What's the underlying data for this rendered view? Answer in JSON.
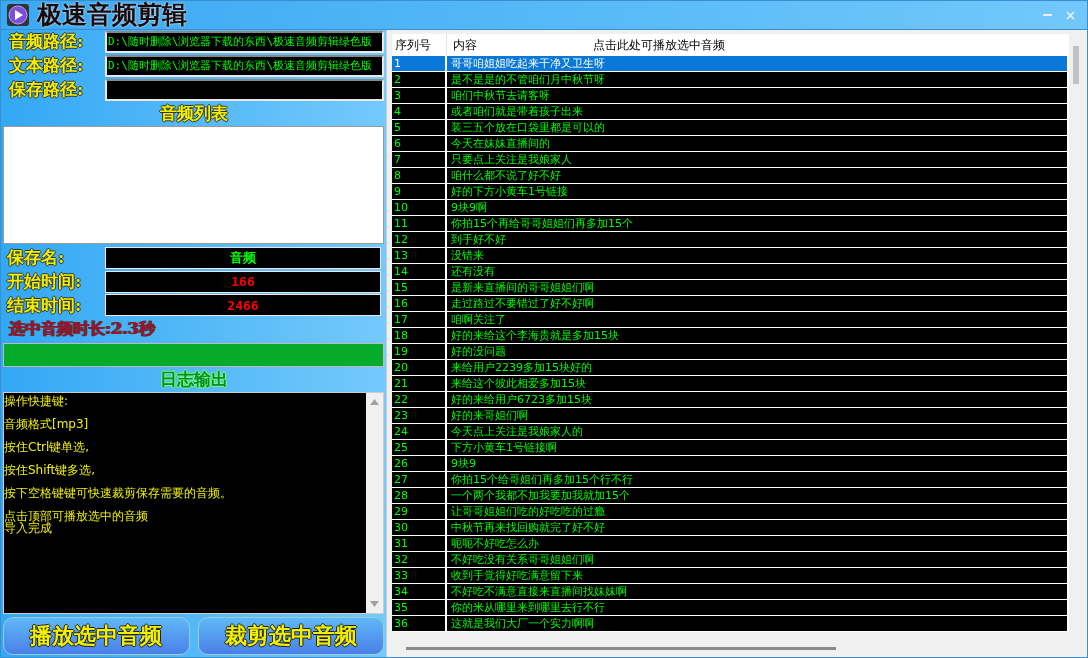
{
  "window": {
    "title": "极速音频剪辑"
  },
  "paths": [
    {
      "label": "音频路径:",
      "value": "D:\\随时删除\\浏览器下载的东西\\极速音频剪辑绿色版"
    },
    {
      "label": "文本路径:",
      "value": "D:\\随时删除\\浏览器下载的东西\\极速音频剪辑绿色版"
    },
    {
      "label": "保存路径:"
    }
  ],
  "audio_list": {
    "title": "音频列表"
  },
  "fields": [
    {
      "label": "保存名:",
      "value": "音频",
      "kind": "name"
    },
    {
      "label": "开始时间:",
      "value": "166",
      "kind": "time"
    },
    {
      "label": "结束时间:",
      "value": "2466",
      "kind": "time"
    }
  ],
  "duration": "选中音频时长:2.3秒",
  "progress": {
    "level": 1
  },
  "log": {
    "title": "日志输出",
    "lines": [
      "操作快捷键:",
      "音频格式[mp3]",
      "按住Ctrl键单选,",
      "按住Shift键多选,",
      "按下空格键键可快速裁剪保存需要的音频。",
      "点击顶部可播放选中的音频",
      "导入完成"
    ]
  },
  "buttons": [
    "播放选中音频",
    "裁剪选中音频"
  ],
  "table": {
    "columns": [
      "序列号",
      "内容",
      "点击此处可播放选中音频"
    ],
    "rows": [
      {
        "no": "1",
        "text": "哥哥咱姐姐吃起来干净又卫生呀",
        "selected": true
      },
      {
        "no": "2",
        "text": "是不是是的不管咱们月中秋节呀",
        "selected": false
      },
      {
        "no": "3",
        "text": "咱们中秋节去请客呀",
        "selected": false
      },
      {
        "no": "4",
        "text": "或者咱们就是带着孩子出来",
        "selected": false
      },
      {
        "no": "5",
        "text": "装三五个放在口袋里都是可以的",
        "selected": false
      },
      {
        "no": "6",
        "text": "今天在妹妹直播间的",
        "selected": false
      },
      {
        "no": "7",
        "text": "只要点上关注是我娘家人",
        "selected": false
      },
      {
        "no": "8",
        "text": "咱什么都不说了好不好",
        "selected": false
      },
      {
        "no": "9",
        "text": "好的下方小黄车1号链接",
        "selected": false
      },
      {
        "no": "10",
        "text": "9块9啊",
        "selected": false
      },
      {
        "no": "11",
        "text": "你拍15个再给哥哥姐姐们再多加15个",
        "selected": false
      },
      {
        "no": "12",
        "text": "到手好不好",
        "selected": false
      },
      {
        "no": "13",
        "text": "没错来",
        "selected": false
      },
      {
        "no": "14",
        "text": "还有没有",
        "selected": false
      },
      {
        "no": "15",
        "text": "是新来直播间的哥哥姐姐们啊",
        "selected": false
      },
      {
        "no": "16",
        "text": "走过路过不要错过了好不好啊",
        "selected": false
      },
      {
        "no": "17",
        "text": "咱啊关注了",
        "selected": false
      },
      {
        "no": "18",
        "text": "好的来给这个李海贵就是多加15块",
        "selected": false
      },
      {
        "no": "19",
        "text": "好的没问题",
        "selected": false
      },
      {
        "no": "20",
        "text": "来给用户2239多加15块好的",
        "selected": false
      },
      {
        "no": "21",
        "text": "来给这个彼此相爱多加15块",
        "selected": false
      },
      {
        "no": "22",
        "text": "好的来给用户6723多加15块",
        "selected": false
      },
      {
        "no": "23",
        "text": "好的来哥姐们啊",
        "selected": false
      },
      {
        "no": "24",
        "text": "今天点上关注是我娘家人的",
        "selected": false
      },
      {
        "no": "25",
        "text": "下方小黄车1号链接啊",
        "selected": false
      },
      {
        "no": "26",
        "text": "9块9",
        "selected": false
      },
      {
        "no": "27",
        "text": "你拍15个给哥姐们再多加15个行不行",
        "selected": false
      },
      {
        "no": "28",
        "text": "一个两个我都不加我要加我就加15个",
        "selected": false
      },
      {
        "no": "29",
        "text": "让哥哥姐姐们吃的好吃吃的过瘾",
        "selected": false
      },
      {
        "no": "30",
        "text": "中秋节再来找回购就完了好不好",
        "selected": false
      },
      {
        "no": "31",
        "text": "呃呃不好吃怎么办",
        "selected": false
      },
      {
        "no": "32",
        "text": "不好吃没有关系哥哥姐姐们啊",
        "selected": false
      },
      {
        "no": "33",
        "text": "收到手觉得好吃满意留下来",
        "selected": false
      },
      {
        "no": "34",
        "text": "不好吃不满意直接来直播间找妹妹啊",
        "selected": false
      },
      {
        "no": "35",
        "text": "你的米从哪里来到哪里去行不行",
        "selected": false
      },
      {
        "no": "36",
        "text": "这就是我们大厂一个实力啊啊",
        "selected": false
      }
    ]
  }
}
